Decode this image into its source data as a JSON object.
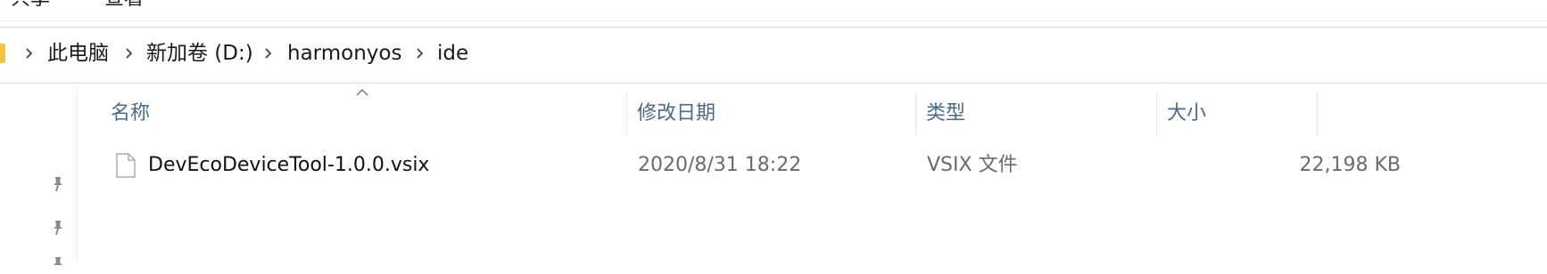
{
  "ribbon": {
    "tabs": [
      "共享",
      "查看"
    ]
  },
  "address_bar": {
    "breadcrumbs": [
      "此电脑",
      "新加卷 (D:)",
      "harmonyos",
      "ide"
    ]
  },
  "icons": {
    "breadcrumb_separator": "chevron-right-icon",
    "pin": "pin-icon",
    "file": "file-icon",
    "sort": "sort-up-icon"
  },
  "file_list": {
    "columns": [
      "名称",
      "修改日期",
      "类型",
      "大小"
    ],
    "rows": [
      {
        "name": "DevEcoDeviceTool-1.0.0.vsix",
        "modified": "2020/8/31 18:22",
        "type": "VSIX 文件",
        "size": "22,198 KB"
      }
    ]
  },
  "colors": {
    "header_text": "#4a6a8c",
    "secondary_text": "#6b6b6b",
    "folder": "#f4c542"
  }
}
